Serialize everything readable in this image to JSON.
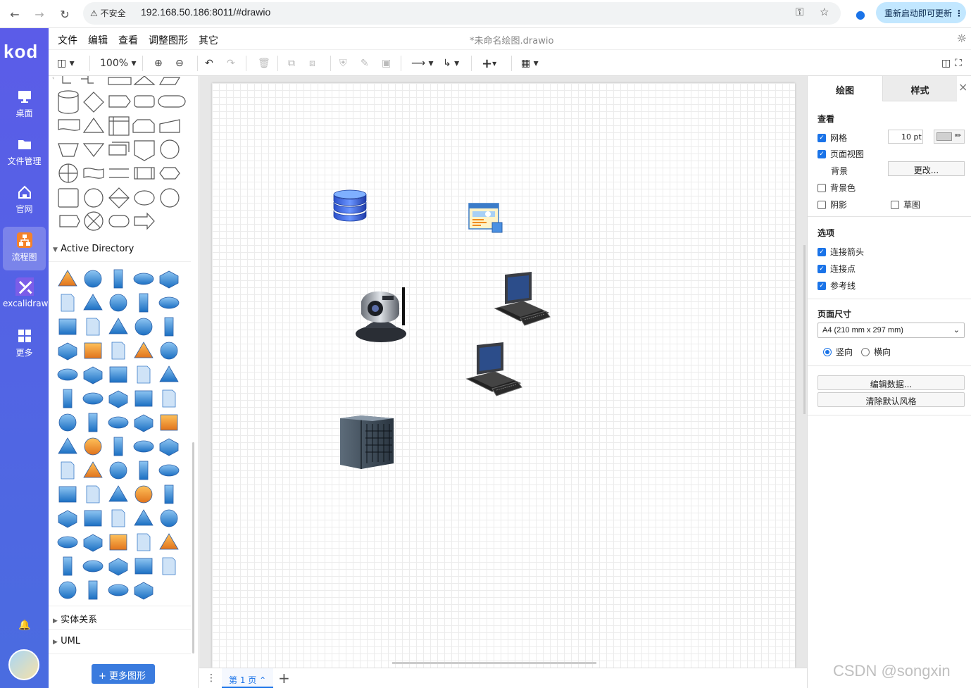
{
  "browser": {
    "insecure_label": "不安全",
    "url": "192.168.50.186:8011/#drawio",
    "update_label": "重新启动即可更新"
  },
  "app": {
    "logo": "kod",
    "nav": [
      {
        "label": "桌面",
        "icon": "monitor-icon"
      },
      {
        "label": "文件管理",
        "icon": "folder-icon"
      },
      {
        "label": "官网",
        "icon": "home-icon"
      },
      {
        "label": "流程图",
        "icon": "flowchart-icon",
        "active": true
      },
      {
        "label": "excalidraw",
        "icon": "excalidraw-icon"
      },
      {
        "label": "更多",
        "icon": "grid-icon"
      }
    ]
  },
  "menubar": {
    "items": [
      "文件",
      "编辑",
      "查看",
      "调整图形",
      "其它"
    ],
    "doc_title": "*未命名绘图.drawio"
  },
  "toolbar": {
    "zoom": "100%"
  },
  "sidebar": {
    "section_active_directory": "Active Directory",
    "section_er": "实体关系",
    "section_uml": "UML",
    "more_shapes": "+ 更多图形"
  },
  "pagebar": {
    "page_tab": "第 1 页"
  },
  "format_panel": {
    "tabs": [
      "绘图",
      "样式"
    ],
    "view_heading": "查看",
    "grid_label": "网格",
    "grid_size": "10 pt",
    "page_view_label": "页面视图",
    "background_label": "背景",
    "change_button": "更改...",
    "bg_color_label": "背景色",
    "shadow_label": "阴影",
    "sketch_label": "草图",
    "options_heading": "选项",
    "connection_arrows": "连接箭头",
    "connection_points": "连接点",
    "guides": "参考线",
    "page_size_heading": "页面尺寸",
    "page_size_value": "A4 (210 mm x 297 mm)",
    "portrait": "竖向",
    "landscape": "横向",
    "edit_data": "编辑数据...",
    "clear_style": "清除默认风格"
  },
  "watermark": "CSDN @songxin"
}
